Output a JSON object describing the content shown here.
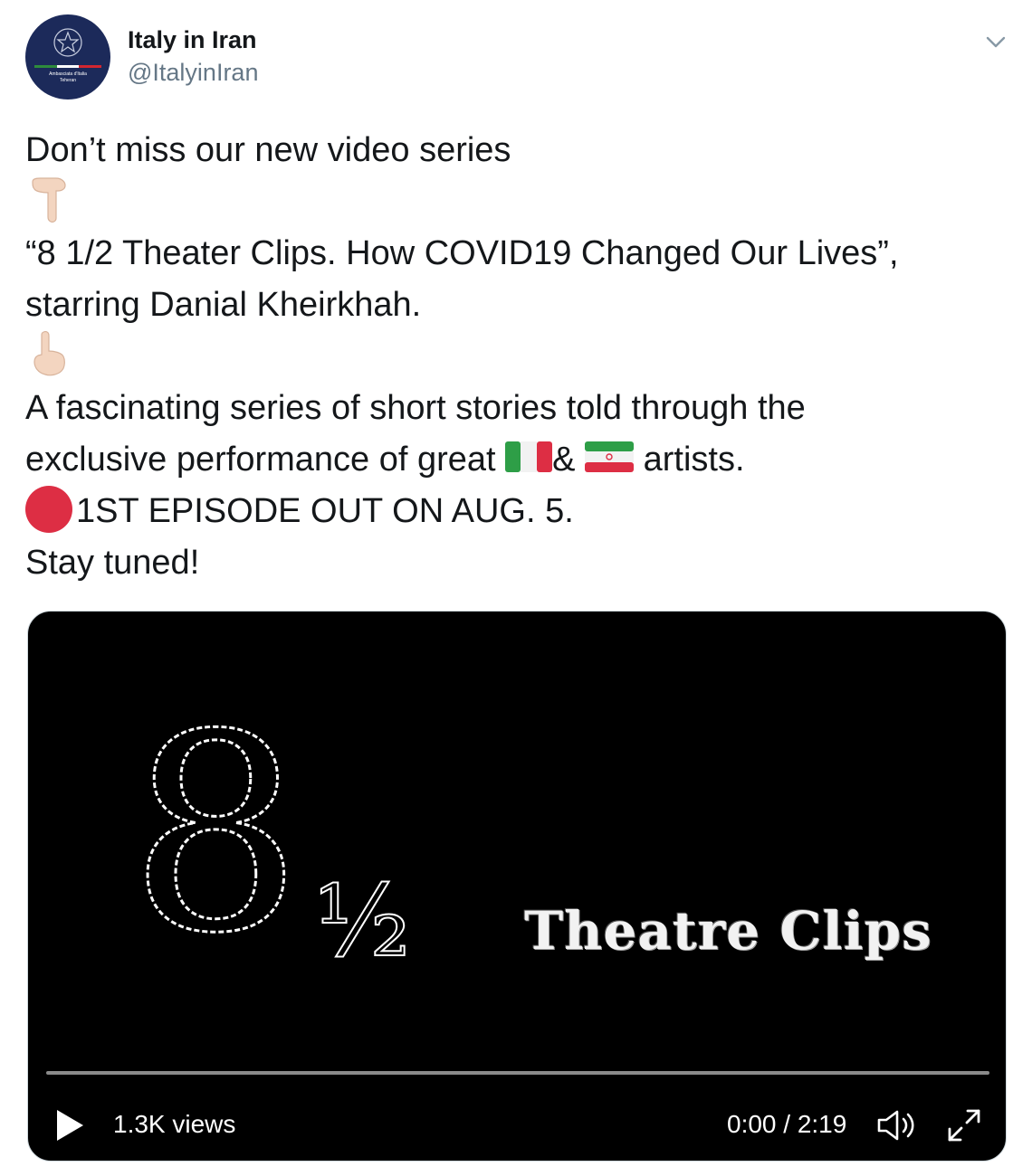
{
  "tweet": {
    "author": {
      "display_name": "Italy in Iran",
      "handle": "@ItalyinIran",
      "avatar_caption": "Ambasciata d'Italia\nTeheran"
    },
    "text": {
      "line1": "Don’t miss our new video series",
      "emoji_down": "point-down-emoji",
      "line2": "“8 1/2 Theater Clips. How COVID19 Changed Our Lives”,",
      "line3": "starring Danial Kheirkhah.",
      "emoji_up": "point-up-emoji",
      "line4": "A fascinating series of short stories told through the",
      "line5_before": "exclusive performance of great ",
      "flag_italy": "italy-flag-emoji",
      "line5_amp": "& ",
      "flag_iran": "iran-flag-emoji",
      "line5_after": " artists.",
      "red_circle": "red-circle-emoji",
      "line6": "1ST EPISODE OUT ON AUG. 5.",
      "line7": "Stay tuned!"
    },
    "video": {
      "logo_numeral": "8",
      "logo_fraction": "½",
      "title": "Theatre Clips",
      "views": "1.3K views",
      "time": "0:00 / 2:19",
      "progress": 0,
      "controls": {
        "play_icon": "play-icon",
        "volume_icon": "volume-icon",
        "fullscreen_icon": "fullscreen-icon"
      }
    },
    "colors": {
      "text": "#14171a",
      "secondary": "#657786",
      "avatar_bg": "#1c2a5a",
      "video_bg": "#000000",
      "red_circle": "#dd2e44"
    }
  }
}
